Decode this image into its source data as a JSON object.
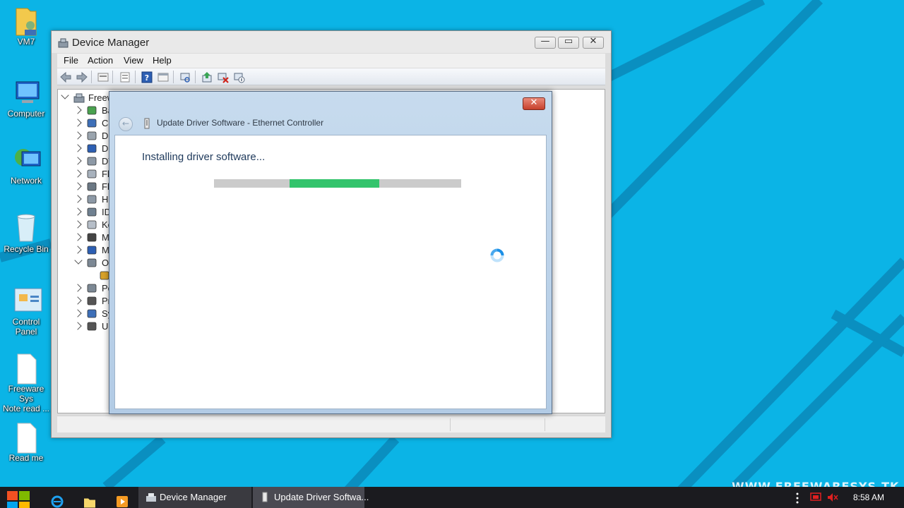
{
  "desktop": {
    "icons": [
      {
        "label": "VM7",
        "icon": "user-folder-icon"
      },
      {
        "label": "Computer",
        "icon": "computer-icon"
      },
      {
        "label": "Network",
        "icon": "network-icon"
      },
      {
        "label": "Recycle Bin",
        "icon": "recycle-bin-icon"
      },
      {
        "label": "Control\nPanel",
        "icon": "control-panel-icon"
      },
      {
        "label": "Freeware Sys\nNote read ...",
        "icon": "text-file-icon"
      },
      {
        "label": "Read me",
        "icon": "text-file-icon"
      }
    ],
    "watermark": "WWW.FREEWARESYS.TK"
  },
  "device_manager": {
    "title": "Device Manager",
    "menu": [
      "File",
      "Action",
      "View",
      "Help"
    ],
    "toolbar_icons": [
      "back-icon",
      "forward-icon",
      "up-icon",
      "properties-icon",
      "help-icon",
      "view-icon",
      "scan-icon",
      "update-driver-icon",
      "uninstall-icon",
      "disable-icon"
    ],
    "tree": {
      "root": "Freew",
      "items": [
        {
          "label": "Ba",
          "icon": "battery-icon",
          "expanded": false
        },
        {
          "label": "Co",
          "icon": "computer-icon",
          "expanded": false
        },
        {
          "label": "Di",
          "icon": "disk-drive-icon",
          "expanded": false
        },
        {
          "label": "Di",
          "icon": "display-adapter-icon",
          "expanded": false
        },
        {
          "label": "DV",
          "icon": "dvd-drive-icon",
          "expanded": false
        },
        {
          "label": "Fl",
          "icon": "floppy-icon",
          "expanded": false
        },
        {
          "label": "Fl",
          "icon": "floppy-controller-icon",
          "expanded": false
        },
        {
          "label": "Hu",
          "icon": "hid-icon",
          "expanded": false
        },
        {
          "label": "ID",
          "icon": "ide-controller-icon",
          "expanded": false
        },
        {
          "label": "Ke",
          "icon": "keyboard-icon",
          "expanded": false
        },
        {
          "label": "M",
          "icon": "mouse-icon",
          "expanded": false
        },
        {
          "label": "M",
          "icon": "monitor-icon",
          "expanded": false
        },
        {
          "label": "Ot",
          "icon": "other-devices-icon",
          "expanded": true
        },
        {
          "label": "",
          "icon": "warning-device-icon",
          "expanded": null
        },
        {
          "label": "Po",
          "icon": "ports-icon",
          "expanded": false
        },
        {
          "label": "Pr",
          "icon": "processor-icon",
          "expanded": false
        },
        {
          "label": "Sy",
          "icon": "system-devices-icon",
          "expanded": false
        },
        {
          "label": "Ur",
          "icon": "usb-icon",
          "expanded": false
        }
      ]
    }
  },
  "dialog": {
    "title": "Update Driver Software - Ethernet Controller",
    "heading": "Installing driver software...",
    "progress": {
      "start": 0.307,
      "end": 0.671
    }
  },
  "taskbar": {
    "buttons": [
      {
        "label": "Device Manager"
      },
      {
        "label": "Update Driver Softwa..."
      }
    ],
    "clock": "8:58 AM"
  }
}
